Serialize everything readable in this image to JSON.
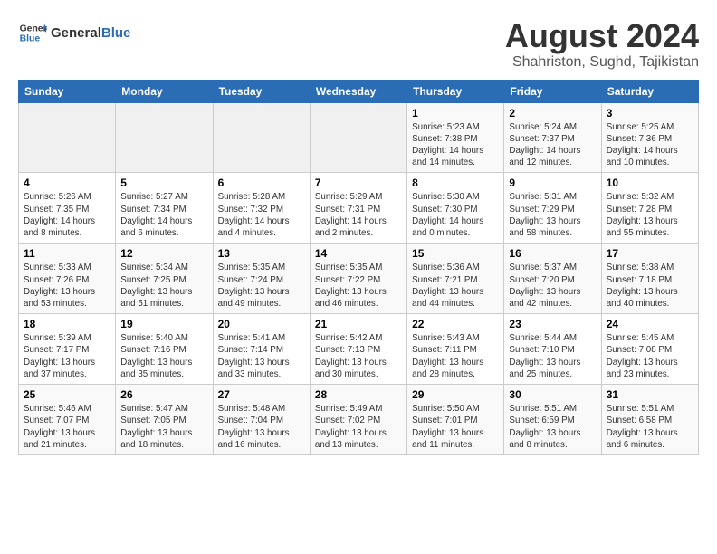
{
  "header": {
    "logo_general": "General",
    "logo_blue": "Blue",
    "title": "August 2024",
    "subtitle": "Shahriston, Sughd, Tajikistan"
  },
  "weekdays": [
    "Sunday",
    "Monday",
    "Tuesday",
    "Wednesday",
    "Thursday",
    "Friday",
    "Saturday"
  ],
  "weeks": [
    [
      {
        "day": "",
        "info": ""
      },
      {
        "day": "",
        "info": ""
      },
      {
        "day": "",
        "info": ""
      },
      {
        "day": "",
        "info": ""
      },
      {
        "day": "1",
        "info": "Sunrise: 5:23 AM\nSunset: 7:38 PM\nDaylight: 14 hours and 14 minutes."
      },
      {
        "day": "2",
        "info": "Sunrise: 5:24 AM\nSunset: 7:37 PM\nDaylight: 14 hours and 12 minutes."
      },
      {
        "day": "3",
        "info": "Sunrise: 5:25 AM\nSunset: 7:36 PM\nDaylight: 14 hours and 10 minutes."
      }
    ],
    [
      {
        "day": "4",
        "info": "Sunrise: 5:26 AM\nSunset: 7:35 PM\nDaylight: 14 hours and 8 minutes."
      },
      {
        "day": "5",
        "info": "Sunrise: 5:27 AM\nSunset: 7:34 PM\nDaylight: 14 hours and 6 minutes."
      },
      {
        "day": "6",
        "info": "Sunrise: 5:28 AM\nSunset: 7:32 PM\nDaylight: 14 hours and 4 minutes."
      },
      {
        "day": "7",
        "info": "Sunrise: 5:29 AM\nSunset: 7:31 PM\nDaylight: 14 hours and 2 minutes."
      },
      {
        "day": "8",
        "info": "Sunrise: 5:30 AM\nSunset: 7:30 PM\nDaylight: 14 hours and 0 minutes."
      },
      {
        "day": "9",
        "info": "Sunrise: 5:31 AM\nSunset: 7:29 PM\nDaylight: 13 hours and 58 minutes."
      },
      {
        "day": "10",
        "info": "Sunrise: 5:32 AM\nSunset: 7:28 PM\nDaylight: 13 hours and 55 minutes."
      }
    ],
    [
      {
        "day": "11",
        "info": "Sunrise: 5:33 AM\nSunset: 7:26 PM\nDaylight: 13 hours and 53 minutes."
      },
      {
        "day": "12",
        "info": "Sunrise: 5:34 AM\nSunset: 7:25 PM\nDaylight: 13 hours and 51 minutes."
      },
      {
        "day": "13",
        "info": "Sunrise: 5:35 AM\nSunset: 7:24 PM\nDaylight: 13 hours and 49 minutes."
      },
      {
        "day": "14",
        "info": "Sunrise: 5:35 AM\nSunset: 7:22 PM\nDaylight: 13 hours and 46 minutes."
      },
      {
        "day": "15",
        "info": "Sunrise: 5:36 AM\nSunset: 7:21 PM\nDaylight: 13 hours and 44 minutes."
      },
      {
        "day": "16",
        "info": "Sunrise: 5:37 AM\nSunset: 7:20 PM\nDaylight: 13 hours and 42 minutes."
      },
      {
        "day": "17",
        "info": "Sunrise: 5:38 AM\nSunset: 7:18 PM\nDaylight: 13 hours and 40 minutes."
      }
    ],
    [
      {
        "day": "18",
        "info": "Sunrise: 5:39 AM\nSunset: 7:17 PM\nDaylight: 13 hours and 37 minutes."
      },
      {
        "day": "19",
        "info": "Sunrise: 5:40 AM\nSunset: 7:16 PM\nDaylight: 13 hours and 35 minutes."
      },
      {
        "day": "20",
        "info": "Sunrise: 5:41 AM\nSunset: 7:14 PM\nDaylight: 13 hours and 33 minutes."
      },
      {
        "day": "21",
        "info": "Sunrise: 5:42 AM\nSunset: 7:13 PM\nDaylight: 13 hours and 30 minutes."
      },
      {
        "day": "22",
        "info": "Sunrise: 5:43 AM\nSunset: 7:11 PM\nDaylight: 13 hours and 28 minutes."
      },
      {
        "day": "23",
        "info": "Sunrise: 5:44 AM\nSunset: 7:10 PM\nDaylight: 13 hours and 25 minutes."
      },
      {
        "day": "24",
        "info": "Sunrise: 5:45 AM\nSunset: 7:08 PM\nDaylight: 13 hours and 23 minutes."
      }
    ],
    [
      {
        "day": "25",
        "info": "Sunrise: 5:46 AM\nSunset: 7:07 PM\nDaylight: 13 hours and 21 minutes."
      },
      {
        "day": "26",
        "info": "Sunrise: 5:47 AM\nSunset: 7:05 PM\nDaylight: 13 hours and 18 minutes."
      },
      {
        "day": "27",
        "info": "Sunrise: 5:48 AM\nSunset: 7:04 PM\nDaylight: 13 hours and 16 minutes."
      },
      {
        "day": "28",
        "info": "Sunrise: 5:49 AM\nSunset: 7:02 PM\nDaylight: 13 hours and 13 minutes."
      },
      {
        "day": "29",
        "info": "Sunrise: 5:50 AM\nSunset: 7:01 PM\nDaylight: 13 hours and 11 minutes."
      },
      {
        "day": "30",
        "info": "Sunrise: 5:51 AM\nSunset: 6:59 PM\nDaylight: 13 hours and 8 minutes."
      },
      {
        "day": "31",
        "info": "Sunrise: 5:51 AM\nSunset: 6:58 PM\nDaylight: 13 hours and 6 minutes."
      }
    ]
  ]
}
